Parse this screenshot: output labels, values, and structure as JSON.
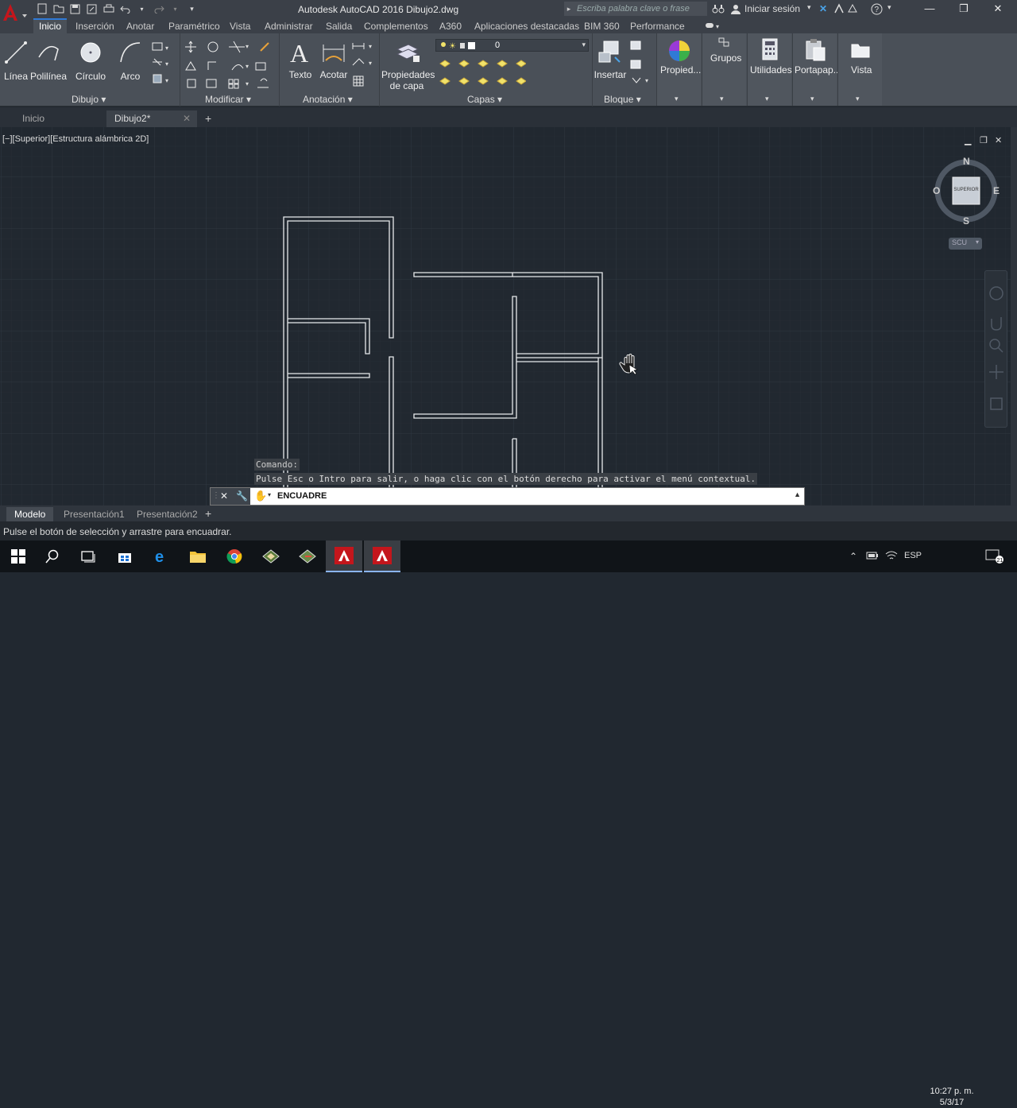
{
  "window": {
    "title": "Autodesk AutoCAD 2016   Dibujo2.dwg",
    "search_placeholder": "Escriba palabra clave o frase",
    "signin_label": "Iniciar sesión"
  },
  "ribbon_tabs": [
    "Inicio",
    "Inserción",
    "Anotar",
    "Paramétrico",
    "Vista",
    "Administrar",
    "Salida",
    "Complementos",
    "A360",
    "Aplicaciones destacadas",
    "BIM 360",
    "Performance"
  ],
  "ribbon": {
    "draw": {
      "title": "Dibujo",
      "linea": "Línea",
      "polilinea": "Polilínea",
      "circulo": "Círculo",
      "arco": "Arco"
    },
    "modify": {
      "title": "Modificar"
    },
    "annotation": {
      "title": "Anotación",
      "texto": "Texto",
      "acotar": "Acotar"
    },
    "layers": {
      "title": "Capas",
      "props_line1": "Propiedades",
      "props_line2": "de capa",
      "current_layer": "0"
    },
    "block": {
      "title": "Bloque",
      "insertar": "Insertar"
    },
    "side": {
      "propiedades": "Propied...",
      "grupos": "Grupos",
      "utilidades": "Utilidades",
      "portapapeles": "Portapap...",
      "vista": "Vista"
    }
  },
  "file_tabs": {
    "start": "Inicio",
    "current": "Dibujo2*"
  },
  "viewport": {
    "label": "[−][Superior][Estructura alámbrica 2D]",
    "viewcube": {
      "north": "N",
      "south": "S",
      "east": "E",
      "west": "O",
      "face": "SUPERIOR",
      "ucs": "SCU"
    }
  },
  "command": {
    "history_label": "Comando:",
    "history_message": "Pulse Esc o Intro para salir, o haga clic con el botón derecho para activar el menú contextual.",
    "current": "ENCUADRE"
  },
  "layout_tabs": [
    "Modelo",
    "Presentación1",
    "Presentación2"
  ],
  "status_message": "Pulse el botón de selección y arrastre para encuadrar.",
  "taskbar": {
    "lang": "ESP",
    "time": "10:27 p. m.",
    "date": "5/3/17",
    "notifications": "21"
  },
  "colors": {
    "accent": "#2f7ad6",
    "canvas": "#212830",
    "autocad_red": "#c4161c"
  }
}
